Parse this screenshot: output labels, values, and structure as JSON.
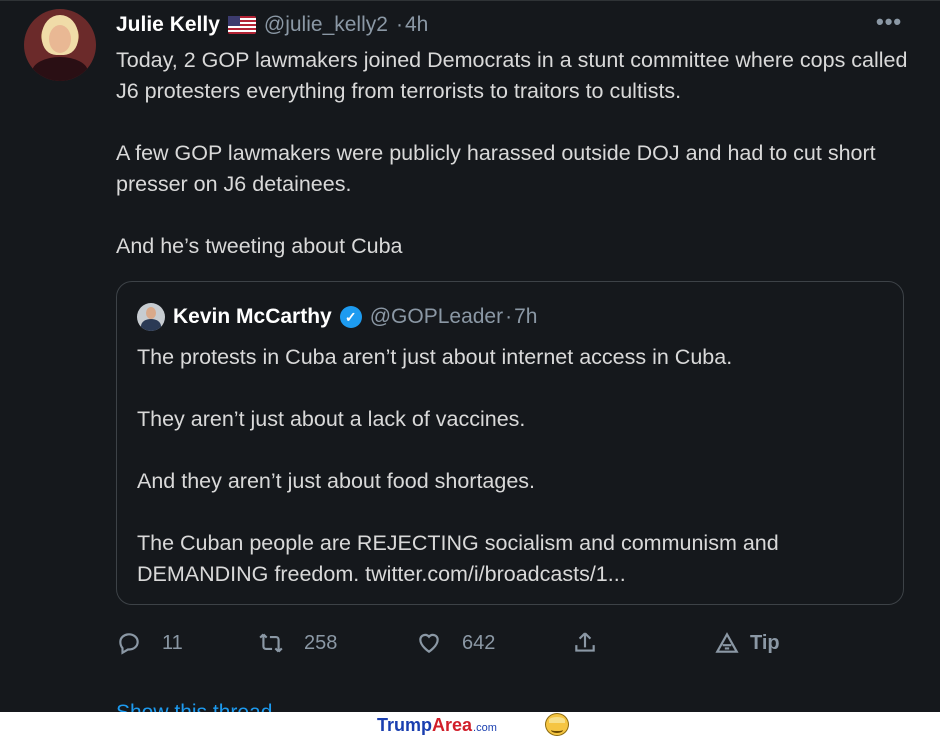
{
  "tweet": {
    "author_name": "Julie Kelly",
    "flag_icon": "us-flag-icon",
    "handle": "@julie_kelly2",
    "separator": "·",
    "time": "4h",
    "more_icon": "•••",
    "paragraphs": [
      "Today, 2 GOP lawmakers joined Democrats in a stunt committee where cops called J6 protesters everything from terrorists to traitors to cultists.",
      "A few GOP lawmakers were publicly harassed outside DOJ and had to cut short presser on J6 detainees.",
      "And he’s tweeting about Cuba"
    ]
  },
  "quoted": {
    "author_name": "Kevin McCarthy",
    "verified_icon": "✓",
    "handle": "@GOPLeader",
    "separator": "·",
    "time": "7h",
    "paragraphs": [
      "The protests in Cuba aren’t just about internet access in Cuba.",
      "They aren’t just about a lack of vaccines.",
      "And they aren’t just about food shortages.",
      "The Cuban people are REJECTING socialism and communism and DEMANDING freedom. twitter.com/i/broadcasts/1..."
    ]
  },
  "actions": {
    "reply_count": "11",
    "retweet_count": "258",
    "like_count": "642",
    "tip_label": "Tip"
  },
  "show_thread": "Show this thread",
  "watermark": {
    "part1": "Trump",
    "part2": "Area",
    "part3": ".com"
  },
  "colors": {
    "background": "#15181c",
    "text": "#d9d9d9",
    "muted": "#8b98a5",
    "accent": "#1d9bf0"
  }
}
